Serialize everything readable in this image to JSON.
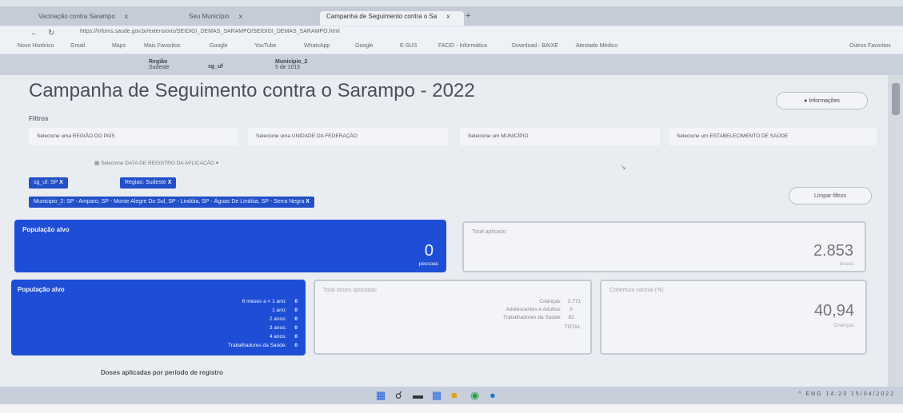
{
  "browser": {
    "tabs": [
      {
        "label": "Vacinação contra Sarampo"
      },
      {
        "label": "Seu Município"
      },
      {
        "label": "Campanha de Seguimento contra o Sa",
        "active": true
      }
    ],
    "tab_close": "x",
    "new_tab": "+",
    "url": "https://infoms.saude.gov.br/extensions/SEIDIGI_DEMAS_SARAMPO/SEIDIGI_DEMAS_SARAMPO.html",
    "bookmarks": [
      "Novo Histórico",
      "Gmail",
      "Maps",
      "Mais Favoritos",
      "Google",
      "YouTube",
      "WhatsApp",
      "Google",
      "E-SUS",
      "FACEI - Informática",
      "Download - BAIXE",
      "Atestado Médico"
    ],
    "favorites_label": "Outros Favoritos",
    "sub_tabs": [
      {
        "label": "Região",
        "value": "Sudeste"
      },
      {
        "label": "sg_uf",
        "value": ""
      },
      {
        "label": "Municipio_2",
        "value": "5 de 1015"
      }
    ]
  },
  "page": {
    "title": "Campanha de Seguimento contra o Sarampo - 2022",
    "info_button": "Informações",
    "filters_label": "Filtros",
    "selects": [
      "Selecione uma REGIÃO DO PAÍS",
      "Selecione uma UNIDADE DA FEDERAÇÃO",
      "Selecione um MUNICÍPIO",
      "Selecione um ESTABELECIMENTO DE SAÚDE"
    ],
    "date_filter": "Selecione DATA DE REGISTRO DA APLICAÇÃO",
    "chips": [
      {
        "key": "sg_uf:",
        "value": "SP",
        "close": "X"
      },
      {
        "key": "Regiao:",
        "value": "Sudeste",
        "close": "X"
      },
      {
        "key": "Municipio_2:",
        "value": "SP - Amparo, SP - Monte Alegre Do Sul, SP - Lindóia, SP - Águas De Lindóia, SP - Serra Negra",
        "close": "X"
      }
    ],
    "clear_filters": "Limpar filtros",
    "kpi_populacao": {
      "title": "População alvo",
      "value": "0",
      "unit": "pessoas"
    },
    "kpi_total": {
      "title": "Total aplicado",
      "value": "2.853",
      "unit": "doses"
    },
    "age_card": {
      "title": "População alvo",
      "rows": [
        {
          "label": "6 meses a < 1 ano:",
          "value": "0"
        },
        {
          "label": "1 ano:",
          "value": "0"
        },
        {
          "label": "2 anos:",
          "value": "0"
        },
        {
          "label": "3 anos:",
          "value": "0"
        },
        {
          "label": "4 anos:",
          "value": "0"
        },
        {
          "label": "Trabalhadores da Saúde:",
          "value": "0"
        }
      ]
    },
    "doses_card": {
      "title": "Total doses aplicadas",
      "rows": [
        {
          "label": "Crianças:",
          "value": "2.771"
        },
        {
          "label": "Adolescentes e Adultos:",
          "value": "0"
        },
        {
          "label": "Trabalhadores da Saúde:",
          "value": "82"
        },
        {
          "label": "",
          "value": "TOTAL"
        }
      ]
    },
    "coverage_card": {
      "title": "Cobertura vacinal (%)",
      "value": "40,94",
      "unit": "Crianças"
    },
    "footer_label": "Doses aplicadas por período de registro"
  },
  "taskbar": {
    "tray_text": "^ ENG 14:23 15/04/2022"
  }
}
